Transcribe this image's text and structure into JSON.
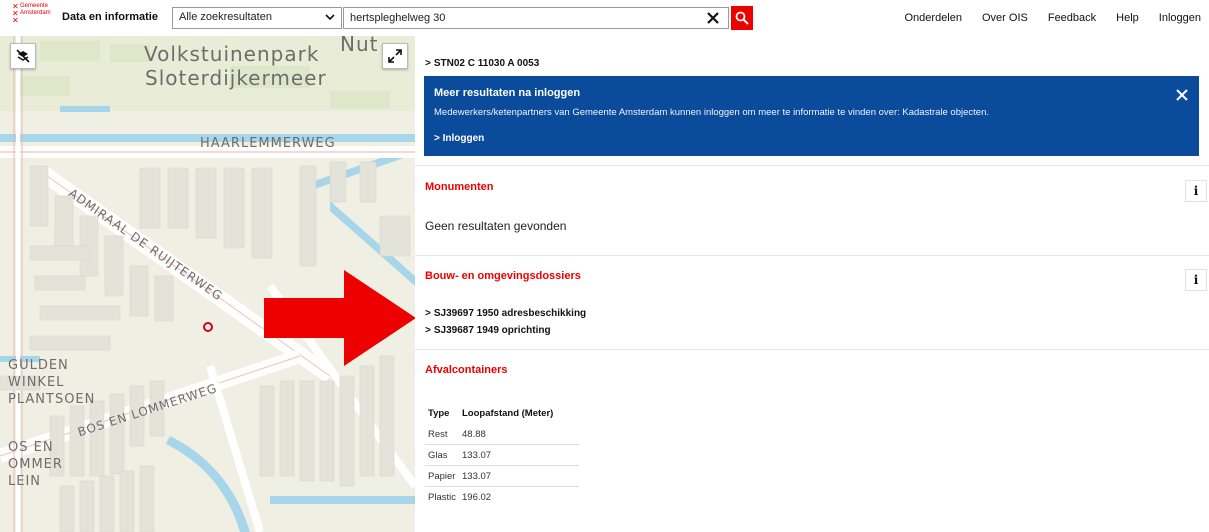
{
  "header": {
    "logo_text": "Gemeente\nAmsterdam",
    "logo_cross": "✕",
    "app_title": "Data en informatie",
    "scope_select": {
      "value": "Alle zoekresultaten"
    },
    "search": {
      "value": "hertspleghelweg 30"
    },
    "nav": [
      "Onderdelen",
      "Over OIS",
      "Feedback",
      "Help",
      "Inloggen"
    ]
  },
  "map": {
    "labels": {
      "park1": "Volkstuinenpark",
      "park2": "Sloterdijkermeer",
      "nut": "Nut",
      "haarlemmerweg": "HAARLEMMERWEG",
      "admiraal": "ADMIRAAL DE RUIJTERWEG",
      "gulden1": "GULDEN",
      "gulden2": "WINKEL",
      "gulden3": "PLANTSOEN",
      "bos": "BOS EN LOMMERWEG",
      "bos2_1": "OS EN",
      "bos2_2": "OMMER",
      "bos2_3": "LEIN"
    },
    "colors": {
      "arrow": "#ec0000",
      "marker": "#d2001e"
    }
  },
  "panel": {
    "top_link": "STN02 C 11030 A 0053",
    "login_box": {
      "title": "Meer resultaten na inloggen",
      "text": "Medewerkers/ketenpartners van Gemeente Amsterdam kunnen inloggen om meer te informatie te vinden over: Kadastrale objecten.",
      "link": "Inloggen"
    },
    "sections": {
      "monumenten": {
        "title": "Monumenten",
        "body": "Geen resultaten gevonden"
      },
      "dossiers": {
        "title": "Bouw- en omgevingsdossiers",
        "items": [
          "SJ39697 1950 adresbeschikking",
          "SJ39687 1949 oprichting"
        ]
      },
      "afval": {
        "title": "Afvalcontainers",
        "columns": [
          "Type",
          "Loopafstand (Meter)"
        ],
        "rows": [
          [
            "Rest",
            "48.88"
          ],
          [
            "Glas",
            "133.07"
          ],
          [
            "Papier",
            "133.07"
          ],
          [
            "Plastic",
            "196.02"
          ]
        ]
      }
    },
    "info_glyph": "i",
    "link_chevron": ">",
    "colors": {
      "accent": "#ec0000",
      "info_box": "#0a4b9b"
    }
  }
}
